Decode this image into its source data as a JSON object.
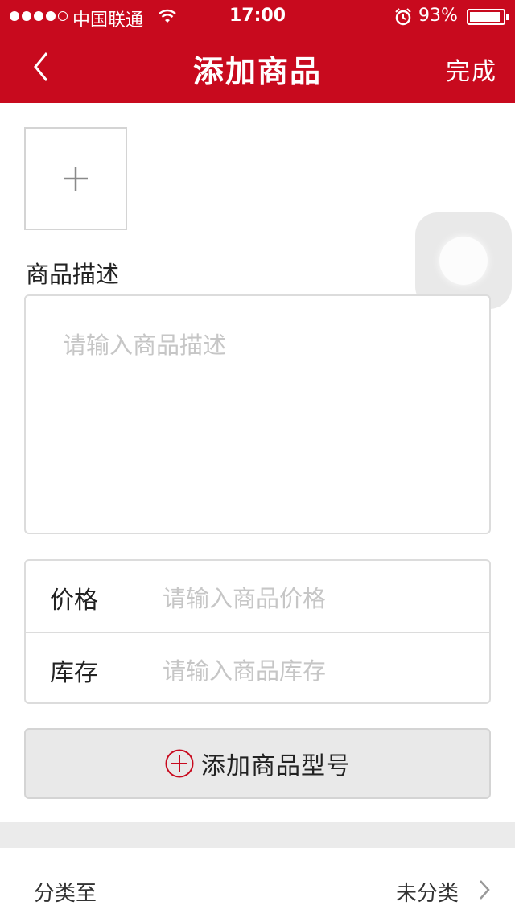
{
  "status_bar": {
    "carrier": "中国联通",
    "time": "17:00",
    "battery_percent": "93%",
    "signal_bars": 4,
    "battery_level": 0.93
  },
  "nav": {
    "title": "添加商品",
    "done_label": "完成",
    "back_icon": "chevron-left-icon"
  },
  "image_picker": {
    "icon": "plus-icon"
  },
  "description": {
    "label": "商品描述",
    "placeholder": "请输入商品描述"
  },
  "price": {
    "label": "价格",
    "placeholder": "请输入商品价格"
  },
  "stock": {
    "label": "库存",
    "placeholder": "请输入商品库存"
  },
  "add_model": {
    "label": "添加商品型号",
    "icon": "plus-circle-icon"
  },
  "category": {
    "label": "分类至",
    "value": "未分类"
  },
  "colors": {
    "brand_red": "#c80a1e",
    "placeholder_gray": "#c6c6c6",
    "border_gray": "#dcdcdc"
  }
}
